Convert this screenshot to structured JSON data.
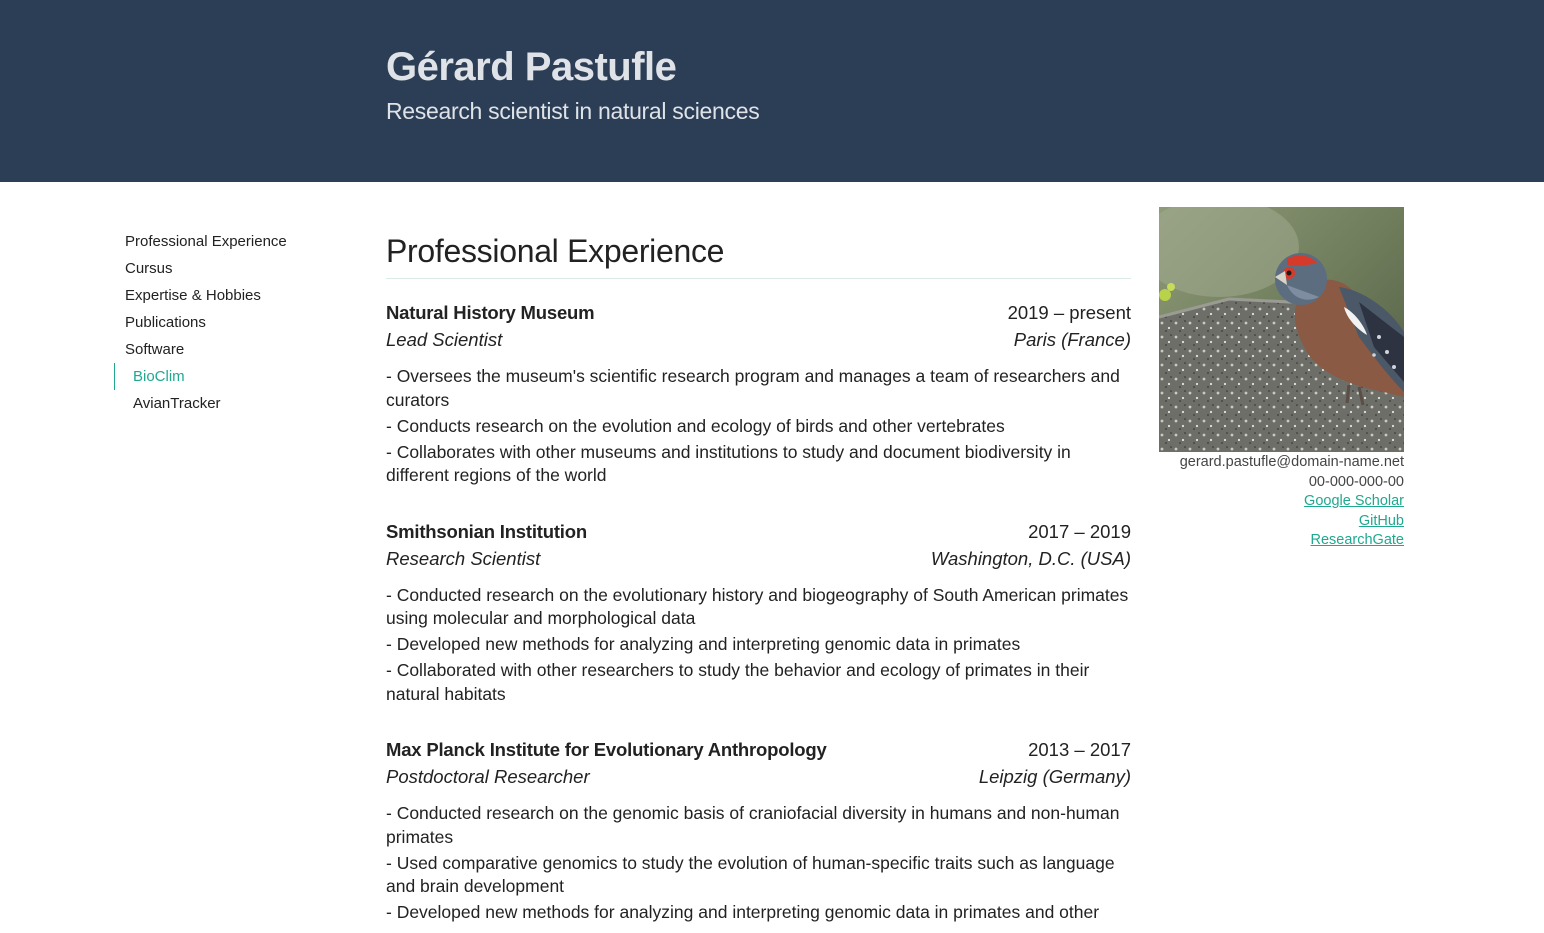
{
  "header": {
    "name": "Gérard Pastufle",
    "tagline": "Research scientist in natural sciences"
  },
  "nav": {
    "items": [
      {
        "label": "Professional Experience"
      },
      {
        "label": "Cursus"
      },
      {
        "label": "Expertise & Hobbies"
      },
      {
        "label": "Publications"
      },
      {
        "label": "Software"
      }
    ],
    "subitems": [
      {
        "label": "BioClim",
        "active": true
      },
      {
        "label": "AvianTracker",
        "active": false
      }
    ]
  },
  "section": {
    "title": "Professional Experience"
  },
  "jobs": [
    {
      "org": "Natural History Museum",
      "dates": "2019 – present",
      "role": "Lead Scientist",
      "place": "Paris (France)",
      "bullets": [
        "- Oversees the museum's scientific research program and manages a team of researchers and curators",
        "- Conducts research on the evolution and ecology of birds and other vertebrates",
        "- Collaborates with other museums and institutions to study and document biodiversity in different regions of the world"
      ]
    },
    {
      "org": "Smithsonian Institution",
      "dates": "2017 – 2019",
      "role": "Research Scientist",
      "place": "Washington, D.C. (USA)",
      "bullets": [
        "- Conducted research on the evolutionary history and biogeography of South American primates using molecular and morphological data",
        "- Developed new methods for analyzing and interpreting genomic data in primates",
        "- Collaborated with other researchers to study the behavior and ecology of primates in their natural habitats"
      ]
    },
    {
      "org": "Max Planck Institute for Evolutionary Anthropology",
      "dates": "2013 – 2017",
      "role": "Postdoctoral Researcher",
      "place": "Leipzig (Germany)",
      "bullets": [
        "- Conducted research on the genomic basis of craniofacial diversity in humans and non-human primates",
        "- Used comparative genomics to study the evolution of human-specific traits such as language and brain development",
        "- Developed new methods for analyzing and interpreting genomic data in primates and other"
      ]
    }
  ],
  "contact": {
    "email": "gerard.pastufle@domain-name.net",
    "phone": "00-000-000-00",
    "links": [
      "Google Scholar",
      "GitHub",
      "ResearchGate"
    ]
  },
  "colors": {
    "header_bg": "#2c3e55",
    "accent": "#20a88f"
  }
}
